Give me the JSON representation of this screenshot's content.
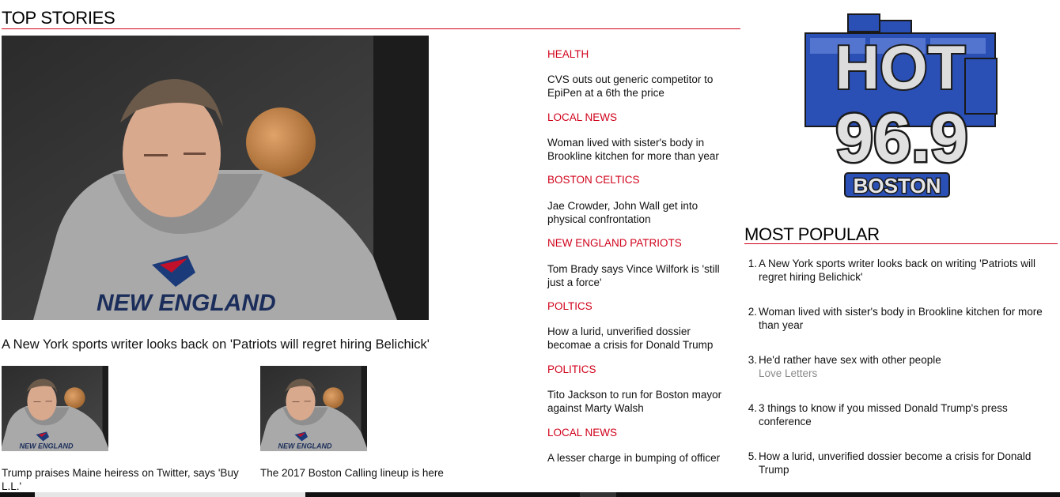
{
  "top_stories": {
    "title": "TOP STORIES",
    "hero": {
      "image_icon": "coach-photo",
      "headline": "A New York sports writer looks back on 'Patriots will regret hiring Belichick'"
    },
    "thumbs": [
      {
        "image_icon": "coach-photo",
        "caption": "Trump praises Maine heiress on Twitter, says 'Buy L.L.'"
      },
      {
        "image_icon": "coach-photo",
        "caption": "The 2017 Boston Calling lineup is here"
      }
    ]
  },
  "side_stories": [
    {
      "category": "HEALTH",
      "headline": "CVS outs out generic competitor to EpiPen at a 6th the price"
    },
    {
      "category": "LOCAL NEWS",
      "headline": "Woman lived with sister's body in Brookline kitchen for more than year"
    },
    {
      "category": "BOSTON CELTICS",
      "headline": "Jae Crowder, John Wall get into physical confrontation"
    },
    {
      "category": "NEW ENGLAND PATRIOTS",
      "headline": "Tom Brady says Vince Wilfork is 'still just a force'"
    },
    {
      "category": "POLTICS",
      "headline": "How a lurid, unverified dossier becomae a crisis for Donald Trump"
    },
    {
      "category": "POLITICS",
      "headline": "Tito Jackson to run for Boston mayor against Marty Walsh"
    },
    {
      "category": "LOCAL NEWS",
      "headline": "A lesser charge in bumping of officer"
    }
  ],
  "station_logo": {
    "line1": "HOT",
    "line2": "96.9",
    "line3": "BOSTON",
    "colors": {
      "blue": "#2a4fb5",
      "silver": "#d9d9d9",
      "dark": "#1a1a1a"
    }
  },
  "most_popular": {
    "title": "MOST POPULAR",
    "items": [
      {
        "num": "1.",
        "text": "A New York sports writer looks back on writing 'Patriots will regret hiring Belichick'",
        "sub": ""
      },
      {
        "num": "2.",
        "text": "Woman lived with sister's body in Brookline kitchen for more than year",
        "sub": ""
      },
      {
        "num": "3.",
        "text": "He'd rather have sex with other people",
        "sub": "Love Letters"
      },
      {
        "num": "4.",
        "text": "3 things to know if you missed Donald Trump's press conference",
        "sub": ""
      },
      {
        "num": "5.",
        "text": "How a lurid, unverified dossier become a crisis for Donald Trump",
        "sub": ""
      }
    ]
  },
  "colors": {
    "accent": "#d0021b",
    "text": "#111111",
    "muted": "#8a8a8a"
  }
}
